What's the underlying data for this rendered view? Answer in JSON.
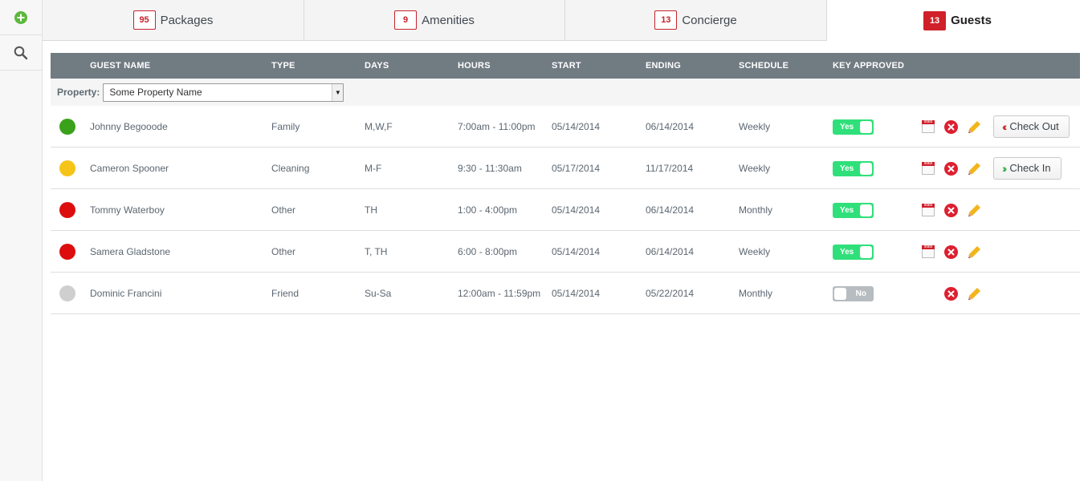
{
  "sidebar": {
    "add_icon": "plus-circle-icon",
    "search_icon": "search-icon"
  },
  "tabs": [
    {
      "badge": "95",
      "label": "Packages",
      "active": false
    },
    {
      "badge": "9",
      "label": "Amenities",
      "active": false
    },
    {
      "badge": "13",
      "label": "Concierge",
      "active": false
    },
    {
      "badge": "13",
      "label": "Guests",
      "active": true
    }
  ],
  "table": {
    "headers": {
      "guest_name": "GUEST NAME",
      "type": "TYPE",
      "days": "DAYS",
      "hours": "HOURS",
      "start": "START",
      "ending": "ENDING",
      "schedule": "SCHEDULE",
      "key_approved": "KEY APPROVED"
    },
    "filter": {
      "label": "Property:",
      "selected": "Some Property Name"
    },
    "calendar_icon_text": "stats",
    "rows": [
      {
        "status_color": "#3aa21a",
        "name": "Johnny Begooode",
        "type": "Family",
        "days": "M,W,F",
        "hours": "7:00am - 11:00pm",
        "start": "05/14/2014",
        "ending": "06/14/2014",
        "schedule": "Weekly",
        "key": "Yes",
        "key_on": true,
        "calendar": true,
        "action": "Check Out",
        "action_dir": "out"
      },
      {
        "status_color": "#f5c419",
        "name": "Cameron Spooner",
        "type": "Cleaning",
        "days": "M-F",
        "hours": "9:30 - 11:30am",
        "start": "05/17/2014",
        "ending": "11/17/2014",
        "schedule": "Weekly",
        "key": "Yes",
        "key_on": true,
        "calendar": true,
        "action": "Check In",
        "action_dir": "in"
      },
      {
        "status_color": "#dd0d0d",
        "name": "Tommy Waterboy",
        "type": "Other",
        "days": "TH",
        "hours": "1:00 - 4:00pm",
        "start": "05/14/2014",
        "ending": "06/14/2014",
        "schedule": "Monthly",
        "key": "Yes",
        "key_on": true,
        "calendar": true,
        "action": "",
        "action_dir": ""
      },
      {
        "status_color": "#dd0d0d",
        "name": "Samera Gladstone",
        "type": "Other",
        "days": "T, TH",
        "hours": "6:00 - 8:00pm",
        "start": "05/14/2014",
        "ending": "06/14/2014",
        "schedule": "Weekly",
        "key": "Yes",
        "key_on": true,
        "calendar": true,
        "action": "",
        "action_dir": ""
      },
      {
        "status_color": "#cfcfcf",
        "name": "Dominic Francini",
        "type": "Friend",
        "days": "Su-Sa",
        "hours": "12:00am - 11:59pm",
        "start": "05/14/2014",
        "ending": "05/22/2014",
        "schedule": "Monthly",
        "key": "No",
        "key_on": false,
        "calendar": false,
        "action": "",
        "action_dir": ""
      }
    ]
  },
  "colors": {
    "header_bg": "#717b82",
    "badge_red": "#d0202a",
    "toggle_on": "#2fe07a",
    "delete_red": "#dd1f30",
    "edit_yellow": "#f2b51c",
    "out_chevron": "#cc2f2f",
    "in_chevron": "#3fb24f"
  }
}
